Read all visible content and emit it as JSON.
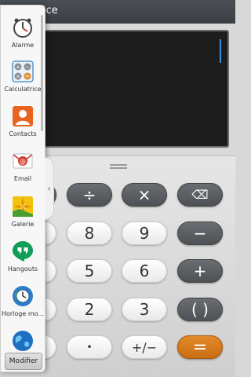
{
  "app": {
    "title": "alculatrice",
    "keys": {
      "divide": "÷",
      "multiply": "×",
      "backspace": "⌫",
      "eight": "8",
      "nine": "9",
      "minus": "−",
      "five": "5",
      "six": "6",
      "plus": "+",
      "two": "2",
      "three": "3",
      "parentheses": "( )",
      "decimal": "•",
      "sign": "+/−",
      "equals": "="
    },
    "colors": {
      "equals_accent": "#d47a1c",
      "cursor": "#3b8fd8"
    }
  },
  "tray": {
    "items": [
      {
        "label": "Alarme",
        "icon": "alarm-clock-icon"
      },
      {
        "label": "Calculatrice",
        "icon": "calculator-icon"
      },
      {
        "label": "Contacts",
        "icon": "contacts-icon"
      },
      {
        "label": "Email",
        "icon": "email-icon"
      },
      {
        "label": "Galerie",
        "icon": "gallery-icon"
      },
      {
        "label": "Hangouts",
        "icon": "hangouts-icon"
      },
      {
        "label": "Horloge mo...",
        "icon": "world-clock-icon"
      },
      {
        "label": "",
        "icon": "internet-icon"
      }
    ],
    "modify_label": "Modifier"
  }
}
